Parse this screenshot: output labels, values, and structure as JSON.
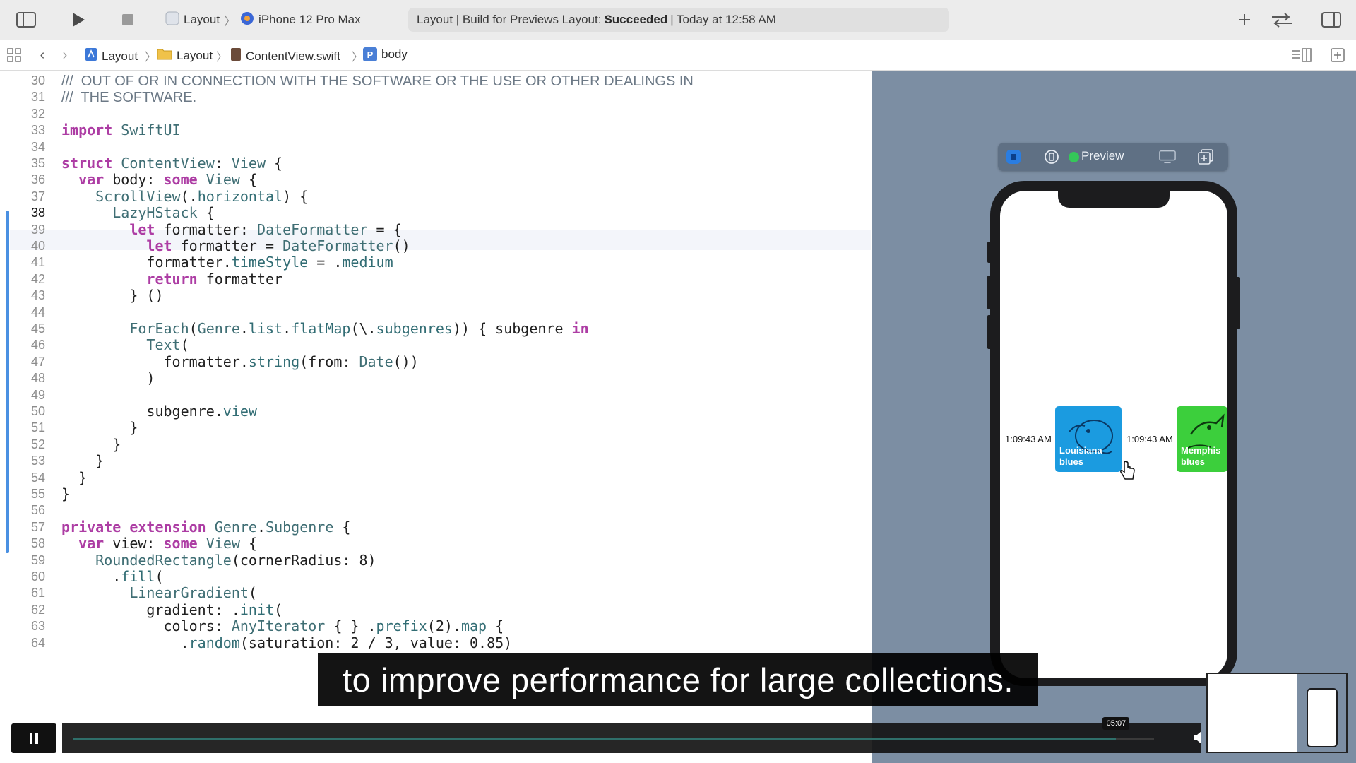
{
  "toolbar": {
    "project": "Layout",
    "device": "iPhone 12 Pro Max",
    "status_prefix": "Layout | Build for Previews Layout:",
    "status_result": "Succeeded",
    "status_suffix": "| Today at 12:58 AM"
  },
  "jumpbar": {
    "crumbs": [
      "Layout",
      "Layout",
      "ContentView.swift",
      "body"
    ]
  },
  "editor": {
    "current_line": "38",
    "lines": [
      {
        "n": "30",
        "text": "///  OUT OF OR IN CONNECTION WITH THE SOFTWARE OR THE USE OR OTHER DEALINGS IN"
      },
      {
        "n": "31",
        "text": "///  THE SOFTWARE."
      },
      {
        "n": "32",
        "text": ""
      },
      {
        "n": "33",
        "text": "import SwiftUI"
      },
      {
        "n": "34",
        "text": ""
      },
      {
        "n": "35",
        "text": "struct ContentView: View {"
      },
      {
        "n": "36",
        "text": "  var body: some View {"
      },
      {
        "n": "37",
        "text": "    ScrollView(.horizontal) {"
      },
      {
        "n": "38",
        "text": "      LazyHStack {"
      },
      {
        "n": "39",
        "text": "        let formatter: DateFormatter = {"
      },
      {
        "n": "40",
        "text": "          let formatter = DateFormatter()"
      },
      {
        "n": "41",
        "text": "          formatter.timeStyle = .medium"
      },
      {
        "n": "42",
        "text": "          return formatter"
      },
      {
        "n": "43",
        "text": "        } ()"
      },
      {
        "n": "44",
        "text": ""
      },
      {
        "n": "45",
        "text": "        ForEach(Genre.list.flatMap(\\.subgenres)) { subgenre in"
      },
      {
        "n": "46",
        "text": "          Text("
      },
      {
        "n": "47",
        "text": "            formatter.string(from: Date())"
      },
      {
        "n": "48",
        "text": "          )"
      },
      {
        "n": "49",
        "text": ""
      },
      {
        "n": "50",
        "text": "          subgenre.view"
      },
      {
        "n": "51",
        "text": "        }"
      },
      {
        "n": "52",
        "text": "      }"
      },
      {
        "n": "53",
        "text": "    }"
      },
      {
        "n": "54",
        "text": "  }"
      },
      {
        "n": "55",
        "text": "}"
      },
      {
        "n": "56",
        "text": ""
      },
      {
        "n": "57",
        "text": "private extension Genre.Subgenre {"
      },
      {
        "n": "58",
        "text": "  var view: some View {"
      },
      {
        "n": "59",
        "text": "    RoundedRectangle(cornerRadius: 8)"
      },
      {
        "n": "60",
        "text": "      .fill("
      },
      {
        "n": "61",
        "text": "        LinearGradient("
      },
      {
        "n": "62",
        "text": "          gradient: .init("
      },
      {
        "n": "63",
        "text": "            colors: AnyIterator { } .prefix(2).map {"
      },
      {
        "n": "64",
        "text": "              .random(saturation: 2 / 3, value: 0.85)"
      }
    ]
  },
  "preview": {
    "label": "Preview",
    "items": [
      {
        "time": "1:09:43 AM",
        "genre": "Louisiana\nblues",
        "color": "#1b9be0"
      },
      {
        "time": "1:09:43 AM",
        "genre": "Memphis\nblues",
        "color": "#3ccf3c"
      }
    ]
  },
  "video": {
    "caption": "to improve performance for large collections.",
    "timestamp": "05:07",
    "progress": 0.965
  }
}
